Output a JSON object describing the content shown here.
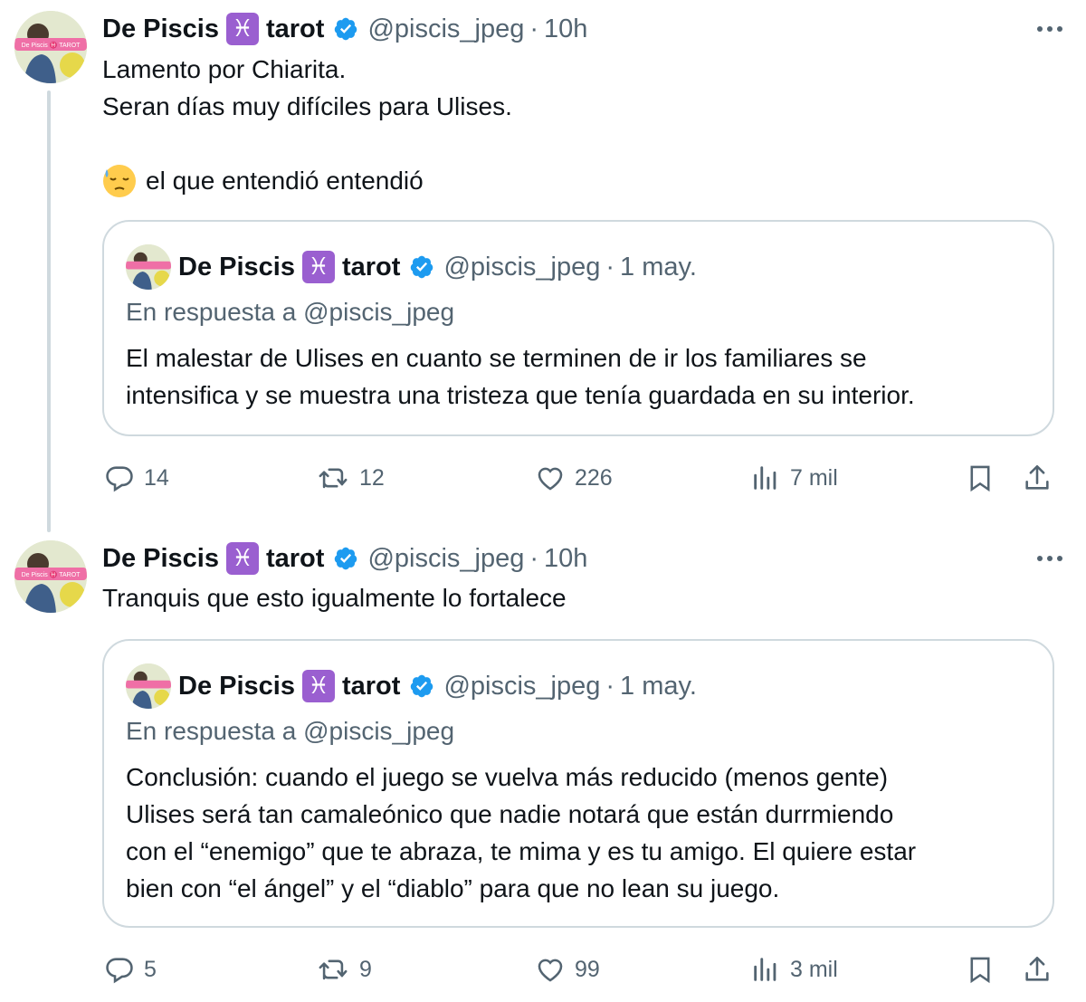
{
  "colors": {
    "text": "#0f1419",
    "secondary": "#536471",
    "verified": "#1d9bf0",
    "pisces_badge": "#9a5fd0",
    "border": "#cfd9de"
  },
  "tweets": [
    {
      "author": {
        "name": "De Piscis",
        "badge": "♓",
        "name_suffix": "tarot",
        "handle": "@piscis_jpeg",
        "separator": "·",
        "time": "10h",
        "avatar_label": "De Piscis ♓ TAROT"
      },
      "lines": [
        "Lamento por Chiarita.",
        "Seran días muy difíciles para Ulises.",
        "",
        "el que entendió entendió"
      ],
      "emoji": "sleepy-face-icon",
      "quote": {
        "author": {
          "name": "De Piscis",
          "badge": "♓",
          "name_suffix": "tarot",
          "handle": "@piscis_jpeg",
          "separator": "·",
          "time": "1 may."
        },
        "reply_to": "En respuesta a @piscis_jpeg",
        "lines": [
          "El malestar de Ulises en cuanto se terminen de ir los familiares se",
          "intensifica y se muestra una tristeza que tenía guardada en su interior."
        ]
      },
      "stats": {
        "replies": "14",
        "retweets": "12",
        "likes": "226",
        "views": "7 mil"
      }
    },
    {
      "author": {
        "name": "De Piscis",
        "badge": "♓",
        "name_suffix": "tarot",
        "handle": "@piscis_jpeg",
        "separator": "·",
        "time": "10h",
        "avatar_label": "De Piscis ♓ TAROT"
      },
      "lines": [
        "Tranquis que esto igualmente lo fortalece"
      ],
      "quote": {
        "author": {
          "name": "De Piscis",
          "badge": "♓",
          "name_suffix": "tarot",
          "handle": "@piscis_jpeg",
          "separator": "·",
          "time": "1 may."
        },
        "reply_to": "En respuesta a @piscis_jpeg",
        "lines": [
          "Conclusión: cuando el juego se vuelva más reducido (menos gente)",
          "Ulises será tan camaleónico que nadie notará que están durrmiendo",
          "con el “enemigo” que te abraza, te mima y es tu amigo. El quiere estar",
          "bien con “el ángel” y el “diablo” para que no lean su juego."
        ]
      },
      "stats": {
        "replies": "5",
        "retweets": "9",
        "likes": "99",
        "views": "3 mil"
      }
    }
  ]
}
